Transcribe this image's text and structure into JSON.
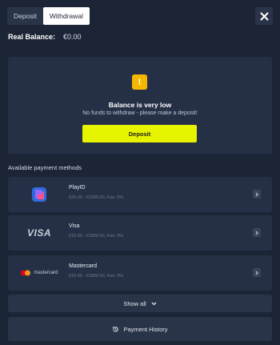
{
  "tabs": {
    "deposit": "Deposit",
    "withdrawal": "Withdrawal"
  },
  "balance": {
    "label": "Real Balance:",
    "value": "€0.00"
  },
  "notice": {
    "icon": "!",
    "title": "Balance is very low",
    "subtitle": "No funds to withdraw - please make a deposit!",
    "button": "Deposit"
  },
  "methods_title": "Available payment methods",
  "methods": [
    {
      "name": "PlayID",
      "info": "€20.00 - €1500.00, Fee: 0%",
      "logo": "playid-logo"
    },
    {
      "name": "Visa",
      "info": "€10.00 - €3000.00, Fee: 0%",
      "logo_text": "VISA"
    },
    {
      "name": "Mastercard",
      "info": "€10.00 - €3000.00, Fee: 0%",
      "logo_text": "mastercard"
    }
  ],
  "show_all": "Show all",
  "payment_history": "Payment History",
  "colors": {
    "background": "#1c2536",
    "card": "#253047",
    "accent_yellow": "#e6f400",
    "warning": "#f5b800"
  }
}
